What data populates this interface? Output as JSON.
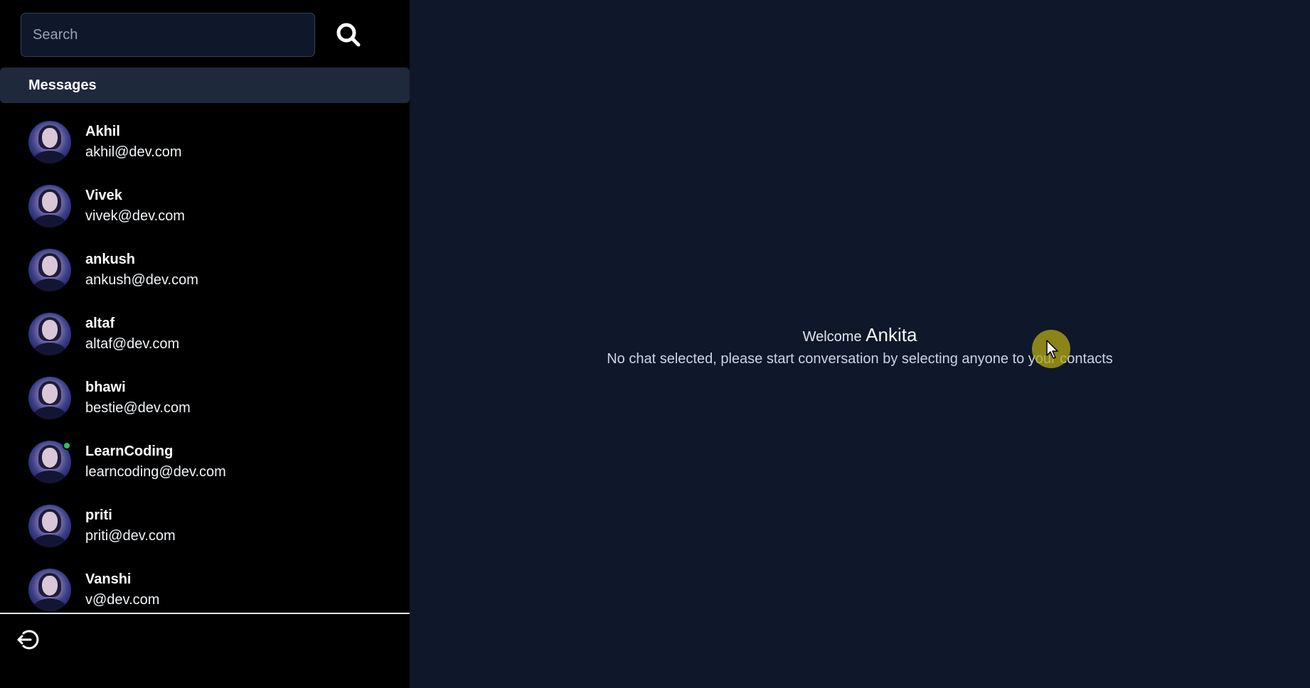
{
  "search": {
    "placeholder": "Search"
  },
  "sidebar": {
    "header_label": "Messages",
    "contacts": [
      {
        "name": "Akhil",
        "email": "akhil@dev.com",
        "online": false
      },
      {
        "name": "Vivek",
        "email": "vivek@dev.com",
        "online": false
      },
      {
        "name": "ankush",
        "email": "ankush@dev.com",
        "online": false
      },
      {
        "name": "altaf",
        "email": "altaf@dev.com",
        "online": false
      },
      {
        "name": "bhawi",
        "email": "bestie@dev.com",
        "online": false
      },
      {
        "name": "LearnCoding",
        "email": "learncoding@dev.com",
        "online": true
      },
      {
        "name": "priti",
        "email": "priti@dev.com",
        "online": false
      },
      {
        "name": "Vanshi",
        "email": "v@dev.com",
        "online": false
      }
    ]
  },
  "main": {
    "welcome_prefix": "Welcome",
    "user_name": "Ankita",
    "empty_message": "No chat selected, please start conversation by selecting anyone to your contacts"
  },
  "icons": {
    "search": "search-icon",
    "logout": "logout-icon"
  },
  "colors": {
    "sidebar_bg": "#000000",
    "main_bg": "#0f172a",
    "header_bg": "#1e293b",
    "online": "#22c55e"
  }
}
